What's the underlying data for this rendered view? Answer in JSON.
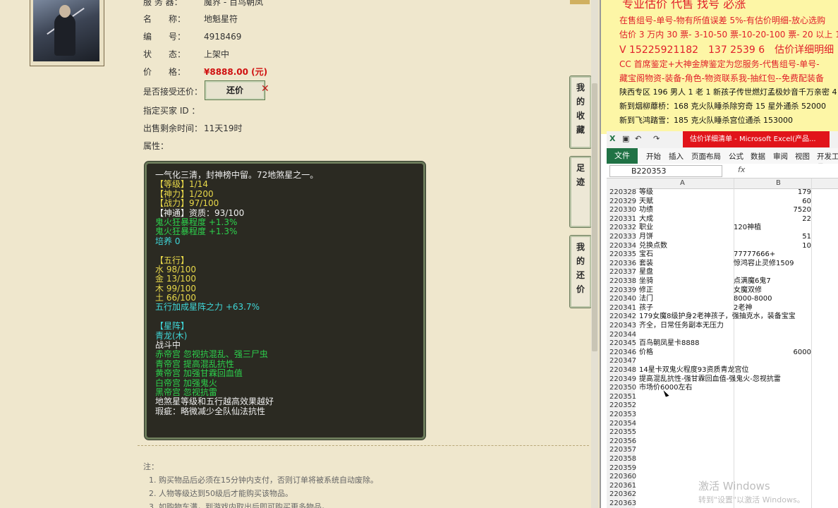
{
  "item": {
    "server_label": "服 务 器：",
    "server_value": "魔界 - 百鸟朝凤",
    "name_label": "名　　称：",
    "name_value": "地魁星符",
    "id_label": "编　　号：",
    "id_value": "4918469",
    "status_label": "状　　态：",
    "status_value": "上架中",
    "price_label": "价　　格：",
    "price_value": "¥8888.00 (元)",
    "bargain_label": "是否接受还价：",
    "bargain_button": "还价",
    "buyer_label": "指定买家 ID ：",
    "buyer_value": "",
    "remaining_label": "出售剩余时间：",
    "remaining_value": "11天19时",
    "attr_label": "属性："
  },
  "attributes": [
    {
      "t": "一气化三清，封神榜中留。72地煞星之一。",
      "c": "w"
    },
    {
      "t": "【等级】1/14",
      "c": "y"
    },
    {
      "t": "【神力】1/200",
      "c": "y"
    },
    {
      "t": "【战力】97/100",
      "c": "y"
    },
    {
      "t": "【神通】资质：93/100",
      "c": "w"
    },
    {
      "t": "鬼火狂暴程度 +1.3%",
      "c": "g"
    },
    {
      "t": "鬼火狂暴程度 +1.3%",
      "c": "g"
    },
    {
      "t": "培养 0",
      "c": "c"
    },
    {
      "t": "",
      "c": "w"
    },
    {
      "t": "【五行】",
      "c": "y"
    },
    {
      "t": "水 98/100",
      "c": "y"
    },
    {
      "t": "金 13/100",
      "c": "y"
    },
    {
      "t": "木 99/100",
      "c": "y"
    },
    {
      "t": "土 66/100",
      "c": "y"
    },
    {
      "t": "五行加成星阵之力 +63.7%",
      "c": "c"
    },
    {
      "t": "",
      "c": "w"
    },
    {
      "t": "【星阵】",
      "c": "c"
    },
    {
      "t": "青龙(木)",
      "c": "c"
    },
    {
      "t": "战斗中",
      "c": "w"
    },
    {
      "t": "赤帝宫 忽视抗混乱、强三尸虫",
      "c": "g"
    },
    {
      "t": "青帝宫 提高混乱抗性",
      "c": "g"
    },
    {
      "t": "黄帝宫 加强甘霖回血值",
      "c": "g"
    },
    {
      "t": "白帝宫 加强鬼火",
      "c": "g"
    },
    {
      "t": "黑帝宫 忽视抗雷",
      "c": "g"
    },
    {
      "t": "地煞星等级和五行越高效果越好",
      "c": "w"
    },
    {
      "t": "瑕疵：略微减少全队仙法抗性",
      "c": "w"
    }
  ],
  "notes": {
    "title": "注：",
    "items": [
      "1. 购买物品后必须在15分钟内支付，否则订单将被系统自动废除。",
      "2. 人物等级达到50级后才能购买该物品。",
      "3. 如购物车满，到游戏内取出后即可购买更多物品。"
    ]
  },
  "side_tabs": [
    {
      "label": "我的收藏"
    },
    {
      "label": "足迹"
    },
    {
      "label": "我的还价"
    }
  ],
  "ads": [
    "专业估价 代售 找号 必涨",
    "在售组号-单号-物有所值误差 5%-有估价明细-放心选购",
    "估价 3 万内 30 票- 3-10-50 票-10-20-100 票- 20 以上 150 票-1 票",
    "V 15225921182　137 2539 6　估价详细明细",
    "CC 首席鉴定+大神金牌鉴定为您服务-代售组号-单号-",
    "藏宝阁物资-装备-角色-物资联系我-抽红包--免费配装备",
    "陕西专区 196 男人 1 老 1 新孩子传世燃灯孟极妙音千万亲密 4",
    "新到烟柳蘼桥：168 克火队睡杀除穷奇 15 星外通杀 52000",
    "新到飞鸿踏雪：185 克火队睡杀宫位通杀 153000"
  ],
  "excel": {
    "title": "估价详细清单 - Microsoft Excel(产品...",
    "file_tab": "文件",
    "tabs": [
      "开始",
      "插入",
      "页面布局",
      "公式",
      "数据",
      "审阅",
      "视图",
      "开发工具"
    ],
    "namebox": "B220353",
    "fx": "fx",
    "col_a": "A",
    "col_b": "B",
    "rows": [
      {
        "n": "220328",
        "a": "等级",
        "b": "179",
        "num": true
      },
      {
        "n": "220329",
        "a": "天赋",
        "b": "60",
        "num": true
      },
      {
        "n": "220330",
        "a": "功绩",
        "b": "7520",
        "num": true
      },
      {
        "n": "220331",
        "a": "大成",
        "b": "22",
        "num": true
      },
      {
        "n": "220332",
        "a": "职业",
        "b": "120神植",
        "num": false
      },
      {
        "n": "220333",
        "a": "月饼",
        "b": "51",
        "num": true
      },
      {
        "n": "220334",
        "a": "兑换点数",
        "b": "10",
        "num": true
      },
      {
        "n": "220335",
        "a": "宝石",
        "b": "77777666+",
        "num": false
      },
      {
        "n": "220336",
        "a": "套装",
        "b": "惊鸿容止灵修1509",
        "num": false
      },
      {
        "n": "220337",
        "a": "星盘",
        "b": "",
        "num": false
      },
      {
        "n": "220338",
        "a": "坐骑",
        "b": "点满魔6鬼7",
        "num": false
      },
      {
        "n": "220339",
        "a": "修正",
        "b": "女魔双修",
        "num": false
      },
      {
        "n": "220340",
        "a": "法门",
        "b": "8000-8000",
        "num": false
      },
      {
        "n": "220341",
        "a": "孩子",
        "b": "2老神",
        "num": false
      },
      {
        "n": "220342",
        "a": "179女魔8级护身2老神孩子，强抽克水，装备宝宝",
        "b": "",
        "num": false
      },
      {
        "n": "220343",
        "a": "齐全，日常任务副本无压力",
        "b": "",
        "num": false
      },
      {
        "n": "220344",
        "a": "",
        "b": "",
        "num": false
      },
      {
        "n": "220345",
        "a": "百鸟朝凤星卡8888",
        "b": "",
        "num": false
      },
      {
        "n": "220346",
        "a": "价格",
        "b": "6000",
        "num": true
      },
      {
        "n": "220347",
        "a": "",
        "b": "",
        "num": false
      },
      {
        "n": "220348",
        "a": "14星卡双鬼火程度93资质青龙宫位",
        "b": "",
        "num": false
      },
      {
        "n": "220349",
        "a": "提高混乱抗性-强甘霖回血值-强鬼火-忽视抗雷",
        "b": "",
        "num": false
      },
      {
        "n": "220350",
        "a": "市场价6000左右",
        "b": "",
        "num": false
      },
      {
        "n": "220351",
        "a": "",
        "b": "",
        "num": false
      },
      {
        "n": "220352",
        "a": "",
        "b": "",
        "num": false
      },
      {
        "n": "220353",
        "a": "",
        "b": "",
        "num": false
      },
      {
        "n": "220354",
        "a": "",
        "b": "",
        "num": false
      },
      {
        "n": "220355",
        "a": "",
        "b": "",
        "num": false
      },
      {
        "n": "220356",
        "a": "",
        "b": "",
        "num": false
      },
      {
        "n": "220357",
        "a": "",
        "b": "",
        "num": false
      },
      {
        "n": "220358",
        "a": "",
        "b": "",
        "num": false
      },
      {
        "n": "220359",
        "a": "",
        "b": "",
        "num": false
      },
      {
        "n": "220360",
        "a": "",
        "b": "",
        "num": false
      },
      {
        "n": "220361",
        "a": "",
        "b": "",
        "num": false
      },
      {
        "n": "220362",
        "a": "",
        "b": "",
        "num": false
      },
      {
        "n": "220363",
        "a": "",
        "b": "",
        "num": false
      }
    ]
  },
  "watermark": {
    "line1": "激活 Windows",
    "line2": "转到\"设置\"以激活 Windows。"
  },
  "colors": {
    "price": "#d01010",
    "panel_bg": "#2b2a22",
    "attr_yellow": "#e8d84a",
    "attr_green": "#2cd24c",
    "attr_cyan": "#3fd6d8",
    "excel_green": "#207245",
    "excel_title_red": "#e1141a",
    "ad_bg": "#fdf6a6"
  }
}
